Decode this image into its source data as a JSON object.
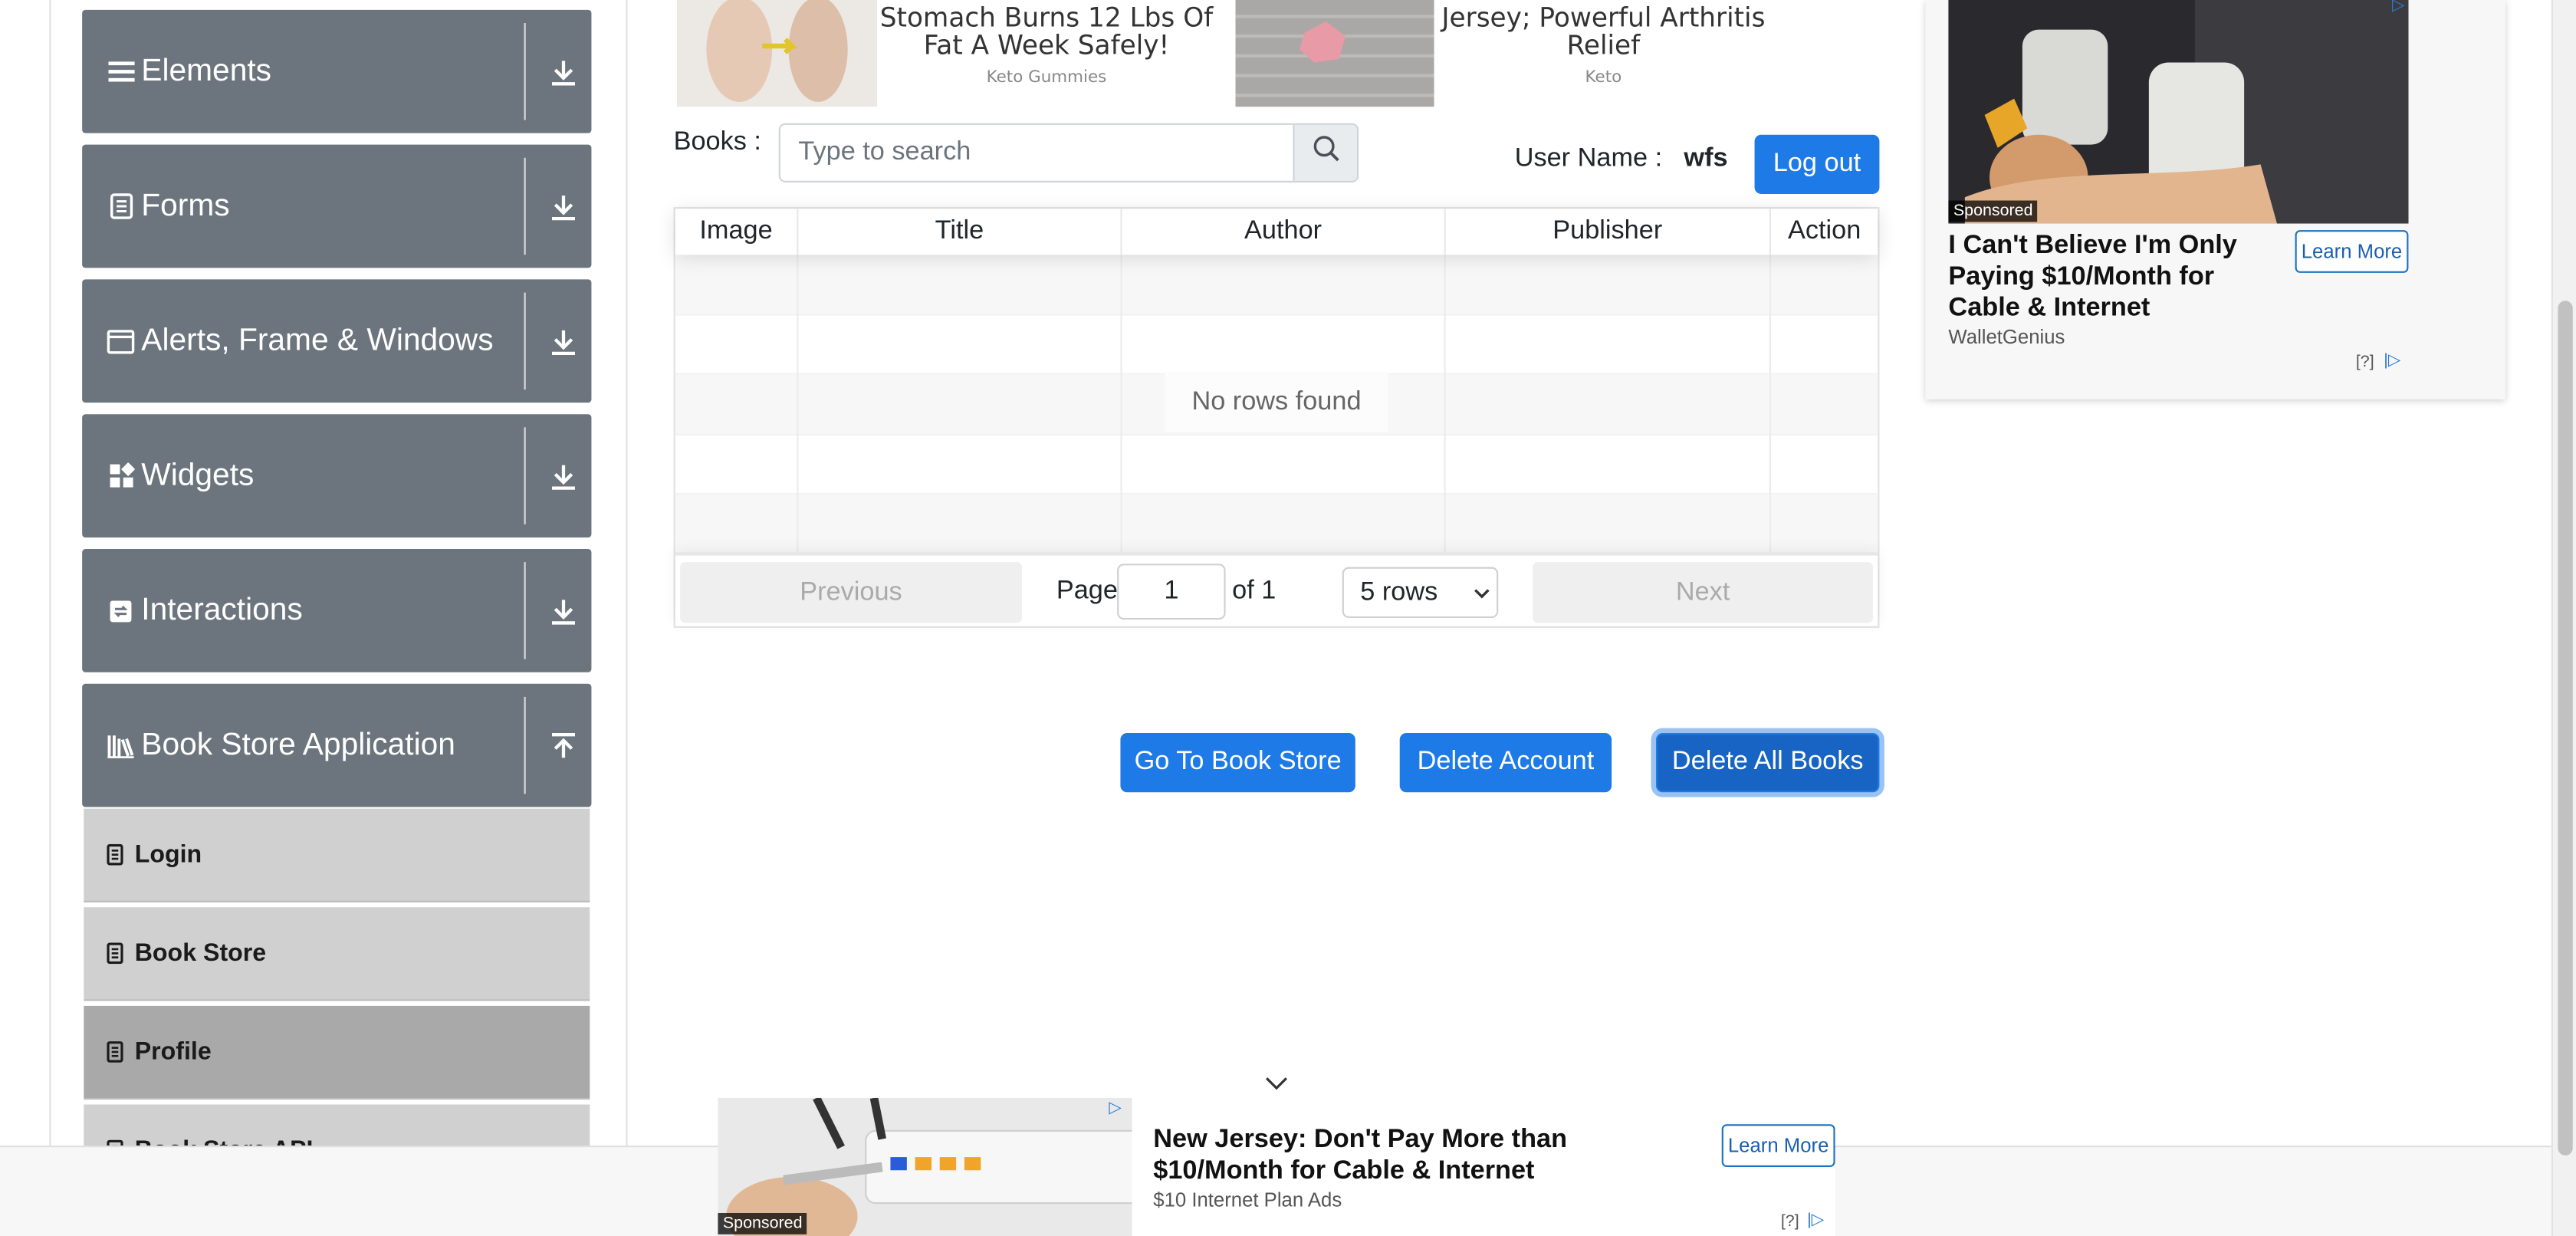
{
  "sidebar": {
    "groups": [
      {
        "label": "Elements",
        "icon": "hamburger-icon",
        "arrow": "download-icon"
      },
      {
        "label": "Forms",
        "icon": "form-icon",
        "arrow": "download-icon"
      },
      {
        "label": "Alerts, Frame & Windows",
        "icon": "window-icon",
        "arrow": "download-icon"
      },
      {
        "label": "Widgets",
        "icon": "widgets-icon",
        "arrow": "download-icon"
      },
      {
        "label": "Interactions",
        "icon": "interactions-icon",
        "arrow": "download-icon"
      },
      {
        "label": "Book Store Application",
        "icon": "books-icon",
        "arrow": "upload-icon"
      }
    ],
    "sub_items": [
      {
        "label": "Login",
        "active": false
      },
      {
        "label": "Book Store",
        "active": false
      },
      {
        "label": "Profile",
        "active": true
      },
      {
        "label": "Book Store API",
        "active": false
      }
    ]
  },
  "top_ads": [
    {
      "text": "Stomach Burns 12 Lbs Of Fat A Week Safely!",
      "source": "Keto Gummies"
    },
    {
      "text": "Jersey; Powerful Arthritis Relief",
      "source": "Keto"
    }
  ],
  "profile": {
    "books_label": "Books :",
    "search_placeholder": "Type to search",
    "user_label": "User Name :",
    "user_value": "wfs",
    "logout_label": "Log out"
  },
  "table": {
    "columns": [
      "Image",
      "Title",
      "Author",
      "Publisher",
      "Action"
    ],
    "empty_text": "No rows found",
    "previous_label": "Previous",
    "next_label": "Next",
    "page_label": "Page",
    "page_value": "1",
    "of_label": "of 1",
    "rows_option": "5 rows"
  },
  "actions": {
    "goto_store": "Go To Book Store",
    "delete_account": "Delete Account",
    "delete_all_books": "Delete All Books"
  },
  "right_ad": {
    "sponsored": "Sponsored",
    "headline": "I Can't Believe I'm Only Paying $10/Month for Cable & Internet",
    "brand": "WalletGenius",
    "cta": "Learn More",
    "adchoices": "[?]"
  },
  "bottom_ad": {
    "sponsored": "Sponsored",
    "headline": "New Jersey: Don't Pay More than $10/Month for Cable & Internet",
    "brand": "$10 Internet Plan Ads",
    "cta": "Learn More",
    "adchoices": "[?]"
  },
  "colors": {
    "group_bg": "#6c757d",
    "primary": "#1e7ae6",
    "sub_item_bg": "#d0d0d0",
    "sub_item_active_bg": "#a9a9a9"
  }
}
